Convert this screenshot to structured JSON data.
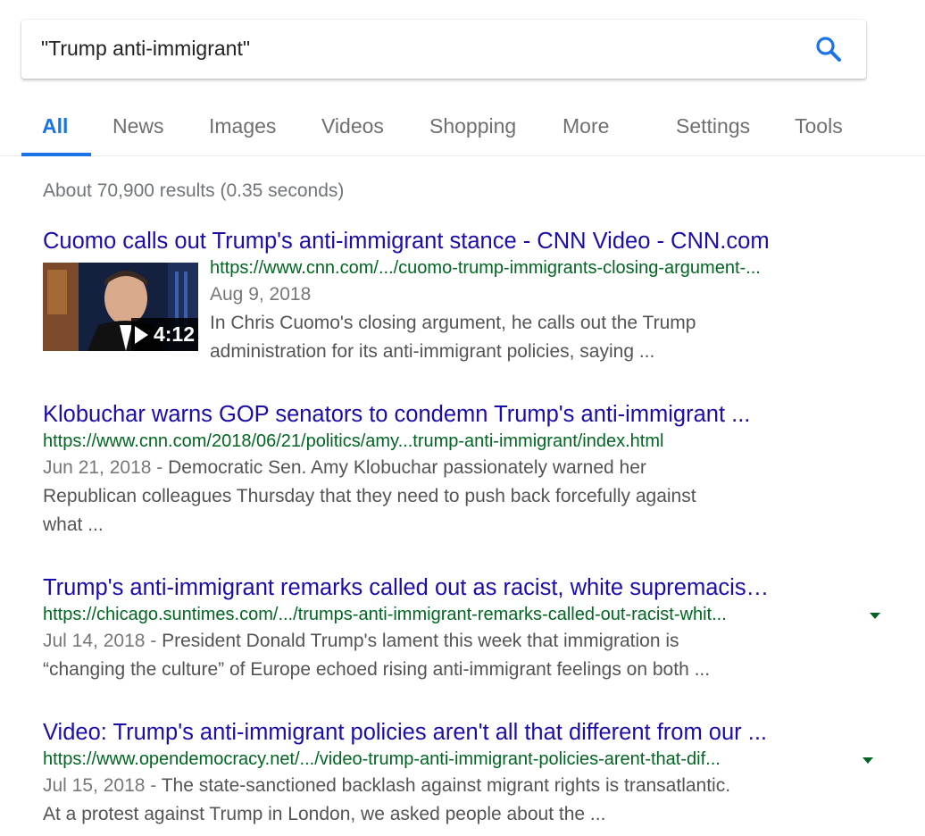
{
  "search": {
    "query": "\"Trump anti-immigrant\"",
    "button_icon": "search-icon",
    "accent_color": "#1a73e8"
  },
  "tabs": [
    {
      "label": "All",
      "active": true
    },
    {
      "label": "News"
    },
    {
      "label": "Images"
    },
    {
      "label": "Videos"
    },
    {
      "label": "Shopping"
    },
    {
      "label": "More"
    },
    {
      "label": "Settings"
    },
    {
      "label": "Tools"
    }
  ],
  "stats": "About 70,900 results (0.35 seconds)",
  "colors": {
    "title": "#1a0dab",
    "url": "#006621",
    "snippet": "#545454",
    "date": "#777777"
  },
  "results": [
    {
      "title": "Cuomo calls out Trump's anti-immigrant stance - CNN Video - CNN.com",
      "url": "https://www.cnn.com/.../cuomo-trump-immigrants-closing-argument-...",
      "date": "Aug 9, 2018",
      "snippet_lines": [
        "In Chris Cuomo's closing argument, he calls out the Trump",
        "administration for its anti-immigrant policies, saying ..."
      ],
      "video": {
        "duration": "4:12",
        "icon": "play-icon"
      }
    },
    {
      "title": "Klobuchar warns GOP senators to condemn Trump's anti-immigrant ...",
      "url": "https://www.cnn.com/2018/06/21/politics/amy...trump-anti-immigrant/index.html",
      "date": "Jun 21, 2018",
      "date_sep": " - ",
      "snippet_lines": [
        "Democratic Sen. Amy Klobuchar passionately warned her",
        "Republican colleagues Thursday that they need to push back forcefully against",
        "what ..."
      ]
    },
    {
      "title": "Trump's anti-immigrant remarks called out as racist, white supremacis…",
      "url": "https://chicago.suntimes.com/.../trumps-anti-immigrant-remarks-called-out-racist-whit...",
      "url_arrow": "dropdown-arrow-icon",
      "date": "Jul 14, 2018",
      "date_sep": " - ",
      "snippet_lines": [
        "President Donald Trump's lament this week that immigration is",
        "“changing the culture” of Europe echoed rising anti-immigrant feelings on both ..."
      ]
    },
    {
      "title": "Video: Trump's anti-immigrant policies aren't all that different from our ...",
      "url": "https://www.opendemocracy.net/.../video-trump-anti-immigrant-policies-arent-that-dif...",
      "url_arrow": "dropdown-arrow-icon",
      "date": "Jul 15, 2018",
      "date_sep": " - ",
      "snippet_lines": [
        "The state-sanctioned backlash against migrant rights is transatlantic.",
        "At a protest against Trump in London, we asked people about the ..."
      ]
    }
  ]
}
